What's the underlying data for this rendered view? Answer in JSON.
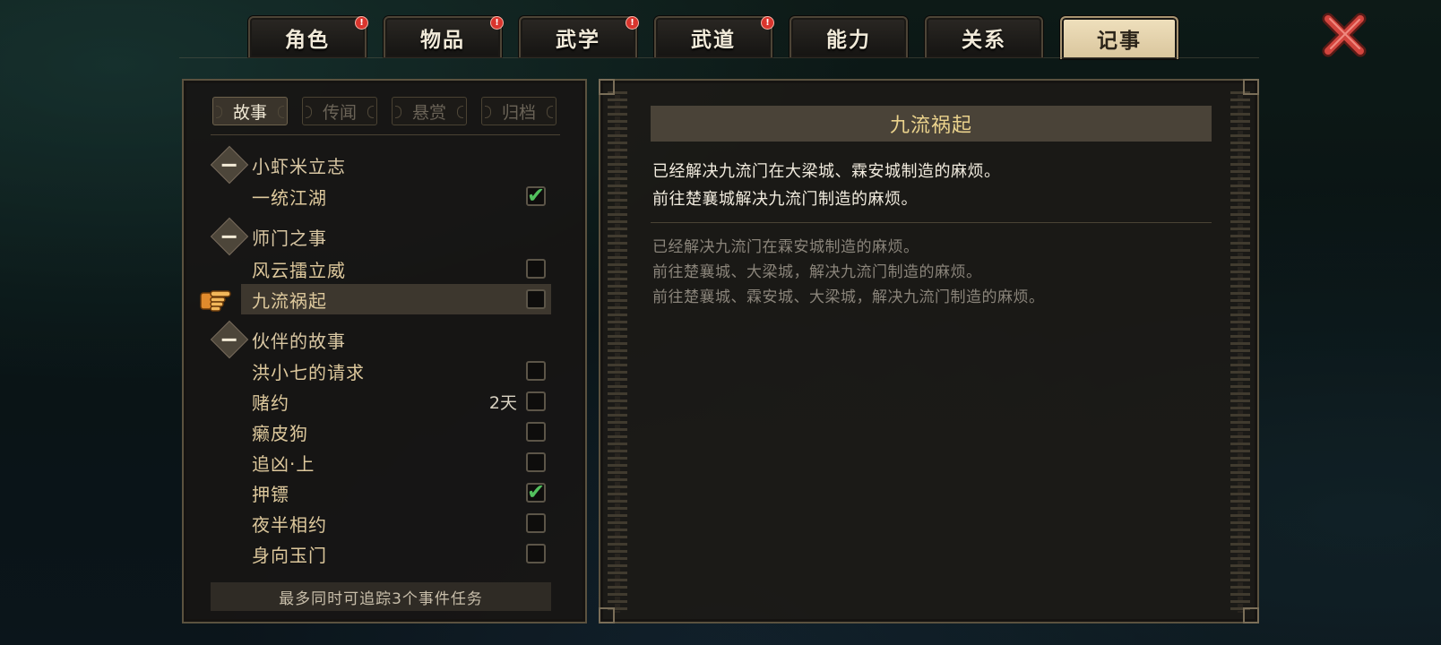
{
  "tabs": [
    {
      "label": "角色",
      "badge": "!"
    },
    {
      "label": "物品",
      "badge": "!"
    },
    {
      "label": "武学",
      "badge": "!"
    },
    {
      "label": "武道",
      "badge": "!"
    },
    {
      "label": "能力",
      "badge": ""
    },
    {
      "label": "关系",
      "badge": ""
    },
    {
      "label": "记事",
      "badge": "",
      "active": true
    }
  ],
  "subtabs": [
    {
      "label": "故事",
      "active": true
    },
    {
      "label": "传闻"
    },
    {
      "label": "悬赏"
    },
    {
      "label": "归档"
    }
  ],
  "groups": [
    {
      "title": "小虾米立志",
      "items": [
        {
          "label": "一统江湖",
          "checked": true
        }
      ]
    },
    {
      "title": "师门之事",
      "items": [
        {
          "label": "风云擂立威",
          "checked": false
        },
        {
          "label": "九流祸起",
          "checked": false,
          "selected": true
        }
      ]
    },
    {
      "title": "伙伴的故事",
      "items": [
        {
          "label": "洪小七的请求",
          "checked": false
        },
        {
          "label": "赌约",
          "checked": false,
          "time": "2天"
        },
        {
          "label": "癞皮狗",
          "checked": false
        },
        {
          "label": "追凶·上",
          "checked": false
        },
        {
          "label": "押镖",
          "checked": true
        },
        {
          "label": "夜半相约",
          "checked": false
        },
        {
          "label": "身向玉门",
          "checked": false
        }
      ]
    }
  ],
  "footer": "最多同时可追踪3个事件任务",
  "detail": {
    "title": "九流祸起",
    "current": [
      "已经解决九流门在大梁城、霖安城制造的麻烦。",
      "前往楚襄城解决九流门制造的麻烦。"
    ],
    "history": [
      "已经解决九流门在霖安城制造的麻烦。",
      "前往楚襄城、大梁城，解决九流门制造的麻烦。",
      "前往楚襄城、霖安城、大梁城，解决九流门制造的麻烦。"
    ]
  },
  "icons": {
    "close": "close-x-icon",
    "pointer": "hand-pointer-icon",
    "group": "collapse-minus-icon",
    "check": "check-icon"
  },
  "colors": {
    "accent": "#ead28c",
    "check": "#52c05d",
    "badge": "#d9352d",
    "close": "#d2453e"
  }
}
